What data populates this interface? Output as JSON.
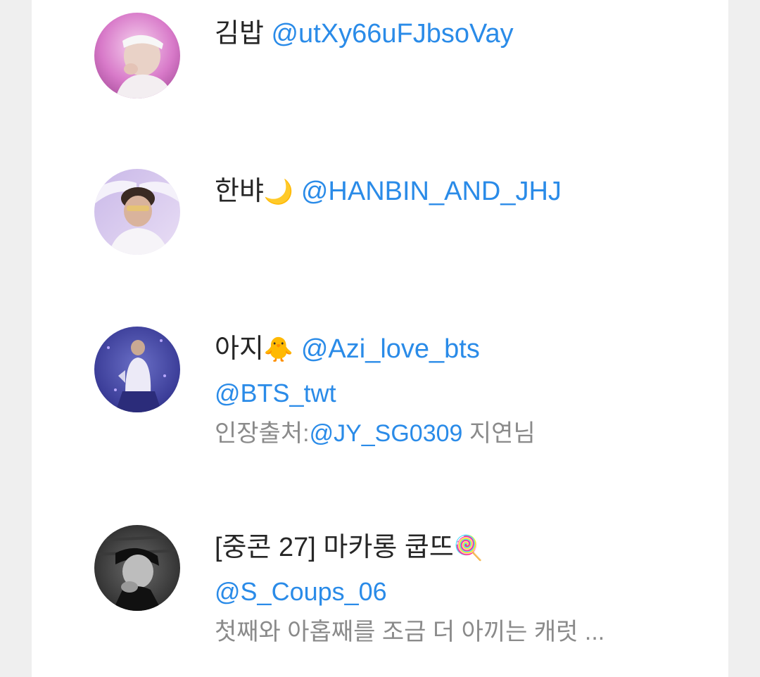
{
  "users": [
    {
      "name": "김밥",
      "emoji": "",
      "handle": "@utXy66uFJbsoVay"
    },
    {
      "name": "한뱌",
      "emoji": "🌙",
      "handle": "@HANBIN_AND_JHJ"
    },
    {
      "name": "아지",
      "emoji": "🐥",
      "handle": "@Azi_love_bts",
      "mention": "@BTS_twt",
      "bio_prefix": "인장출처:",
      "bio_link": "@JY_SG0309",
      "bio_suffix": " 지연님"
    },
    {
      "name": "[중콘 27] 마카롱 쿱뜨",
      "emoji": "🍭",
      "handle": "@S_Coups_06",
      "bio": "첫째와 아홉째를 조금 더 아끼는 캐럿 ..."
    }
  ],
  "colors": {
    "link": "#2a8be8",
    "name": "#262626",
    "bio": "#8a8a8a",
    "background": "#efefef",
    "card": "#ffffff"
  },
  "icons": [
    "user-avatar-1",
    "user-avatar-2",
    "user-avatar-3",
    "user-avatar-4"
  ]
}
